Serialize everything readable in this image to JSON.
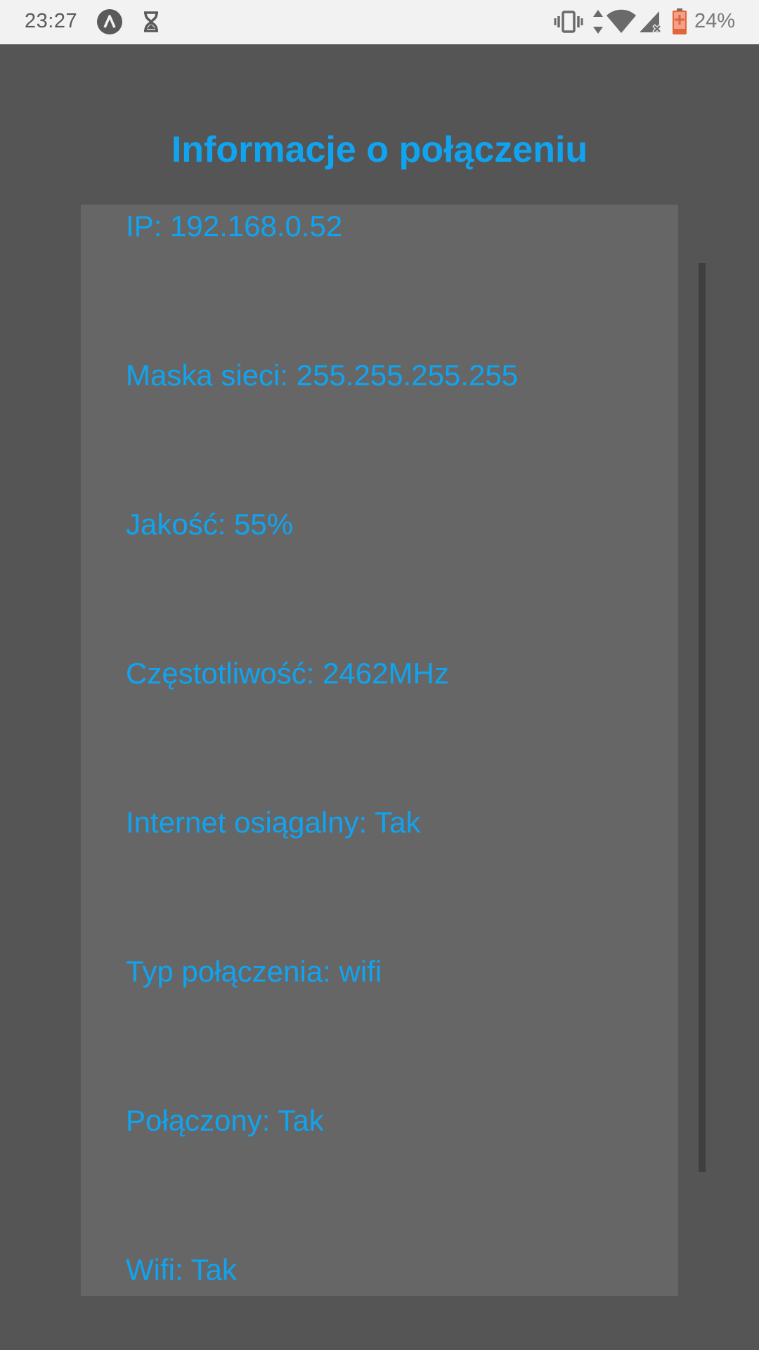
{
  "status_bar": {
    "time": "23:27",
    "battery_percent": "24%",
    "icons": [
      "app-notification-icon",
      "hourglass-icon",
      "vibrate-icon",
      "data-arrows-icon",
      "wifi-icon",
      "cellular-no-signal-icon",
      "battery-charging-icon"
    ]
  },
  "screen": {
    "title": "Informacje o połączeniu",
    "rows": [
      "IP: 192.168.0.52",
      "Maska sieci: 255.255.255.255",
      "Jakość: 55%",
      "Częstotliwość: 2462MHz",
      "Internet osiągalny: Tak",
      "Typ połączenia: wifi",
      "Połączony: Tak",
      "Wifi: Tak"
    ]
  },
  "colors": {
    "accent": "#10a4f0",
    "background": "#555555",
    "panel": "#666666",
    "status_bar": "#f2f2f2",
    "battery_accent": "#e2643a"
  }
}
